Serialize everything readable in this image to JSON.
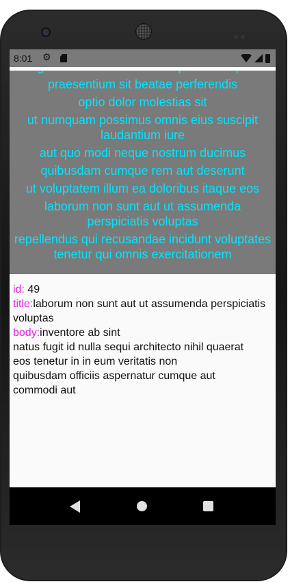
{
  "status_bar": {
    "time": "8:01",
    "settings_icon": "gear-icon",
    "sd_icon": "sd-card-icon",
    "wifi_icon": "wifi-icon",
    "signal_icon": "signal-icon",
    "battery_icon": "battery-icon"
  },
  "list": {
    "items": [
      "eligendi iste nostrum consequuntur adipisci",
      "praesentium sit beatae perferendis",
      "optio dolor molestias sit",
      "ut numquam possimus omnis eius suscipit laudantium iure",
      "aut quo modi neque nostrum ducimus",
      "quibusdam cumque rem aut deserunt",
      "ut voluptatem illum ea doloribus itaque eos",
      "laborum non sunt aut ut assumenda perspiciatis voluptas",
      "repellendus qui recusandae incidunt voluptates tenetur qui omnis exercitationem"
    ]
  },
  "detail": {
    "id_label": "id:",
    "id_value": " 49",
    "title_label": "title:",
    "title_value": "laborum non sunt aut ut assumenda perspiciatis voluptas",
    "body_label": "body:",
    "body_line1": "inventore ab sint",
    "body_line2": "natus fugit id nulla sequi architecto nihil quaerat",
    "body_line3": "eos tenetur in in eum veritatis non",
    "body_line4": "quibusdam officiis aspernatur cumque aut",
    "body_line5": "commodi aut"
  },
  "nav": {
    "back_icon": "back-triangle-icon",
    "home_icon": "home-circle-icon",
    "recents_icon": "recents-square-icon"
  },
  "colors": {
    "list_background": "#7a7a7a",
    "list_text": "#00e5ff",
    "label_text": "#e81ee8",
    "body_text": "#111111",
    "screen_background": "#fafafa"
  }
}
